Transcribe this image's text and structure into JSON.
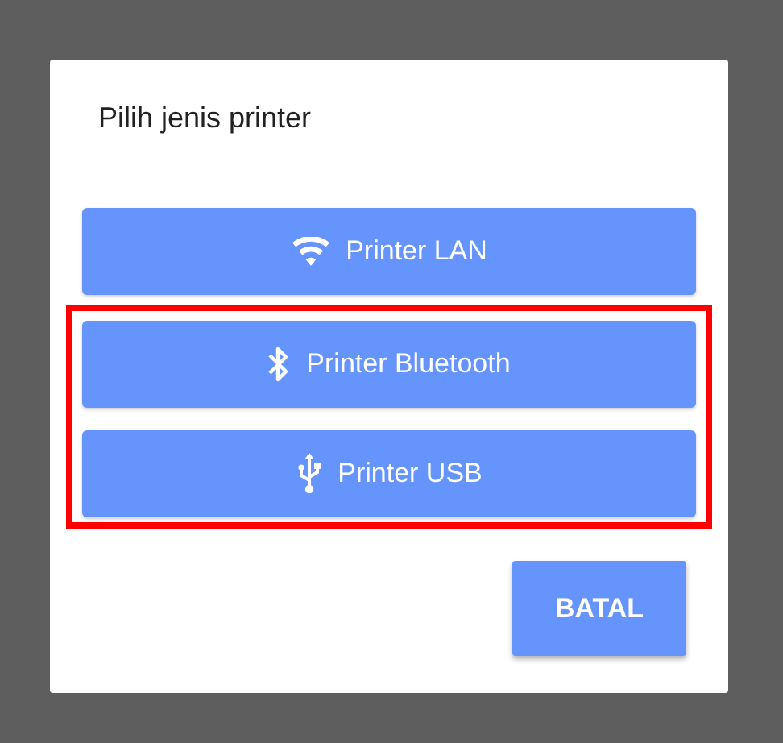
{
  "dialog": {
    "title": "Pilih jenis printer",
    "options": [
      {
        "kind": "wifi",
        "label": "Printer LAN",
        "highlighted": false
      },
      {
        "kind": "bluetooth",
        "label": "Printer Bluetooth",
        "highlighted": true
      },
      {
        "kind": "usb",
        "label": "Printer USB",
        "highlighted": true
      }
    ],
    "buttons": [
      "BATAL"
    ]
  }
}
